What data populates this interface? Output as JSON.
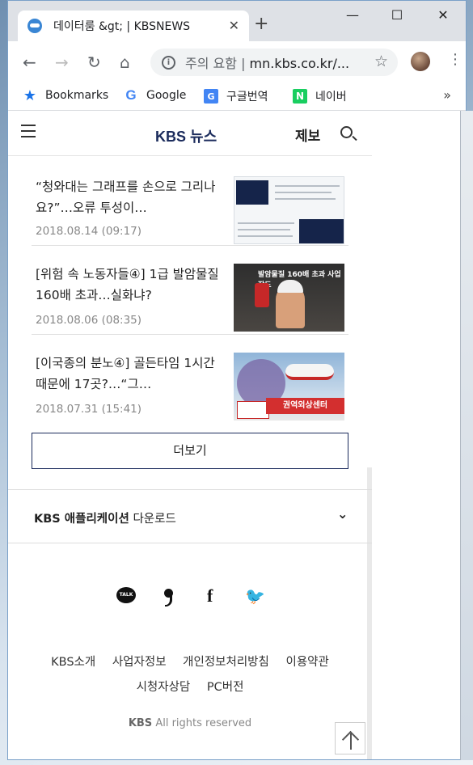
{
  "browser": {
    "tab_title": "데이터룸 &gt; | KBSNEWS",
    "new_tab": "+",
    "close_tab": "✕",
    "controls": {
      "minimize": "—",
      "maximize": "☐",
      "close": "✕"
    },
    "nav": {
      "back": "←",
      "forward": "→",
      "reload": "↻",
      "home": "⌂"
    },
    "omnibox": {
      "security": "주의 요함",
      "separator": "|",
      "url": "mn.kbs.co.kr/..."
    },
    "bookmarks": [
      {
        "label": "Bookmarks",
        "icon": "star-icon"
      },
      {
        "label": "Google",
        "icon": "google-icon"
      },
      {
        "label": "구글번역",
        "icon": "translate-icon"
      },
      {
        "label": "네이버",
        "icon": "naver-icon"
      }
    ],
    "more": "»"
  },
  "site": {
    "logo": "KBS",
    "logo_sub": "뉴스",
    "report": "제보"
  },
  "articles": [
    {
      "title": "“청와대는 그래프를 손으로 그리나요?”…오류 투성이…",
      "date": "2018.08.14 (09:17)"
    },
    {
      "title": "[위험 속 노동자들④] 1급 발암물질 160배 초과…실화냐?",
      "date": "2018.08.06 (08:35)"
    },
    {
      "title": "[이국종의 분노④] 골든타임 1시간 때문에 17곳?…“그…",
      "date": "2018.07.31 (15:41)"
    }
  ],
  "thumb_text": {
    "t2": "발암물질 160배 초과 사업장도",
    "t3": "권역외상센터"
  },
  "more_button": "더보기",
  "app_download": {
    "prefix": "KBS 애플리케이션",
    "suffix": "다운로드"
  },
  "social": {
    "talk": "TALK"
  },
  "footer": {
    "links": [
      "KBS소개",
      "사업자정보",
      "개인정보처리방침",
      "이용약관",
      "시청자상담",
      "PC버전"
    ],
    "copyright_brand": "KBS",
    "copyright_text": "All rights reserved"
  }
}
